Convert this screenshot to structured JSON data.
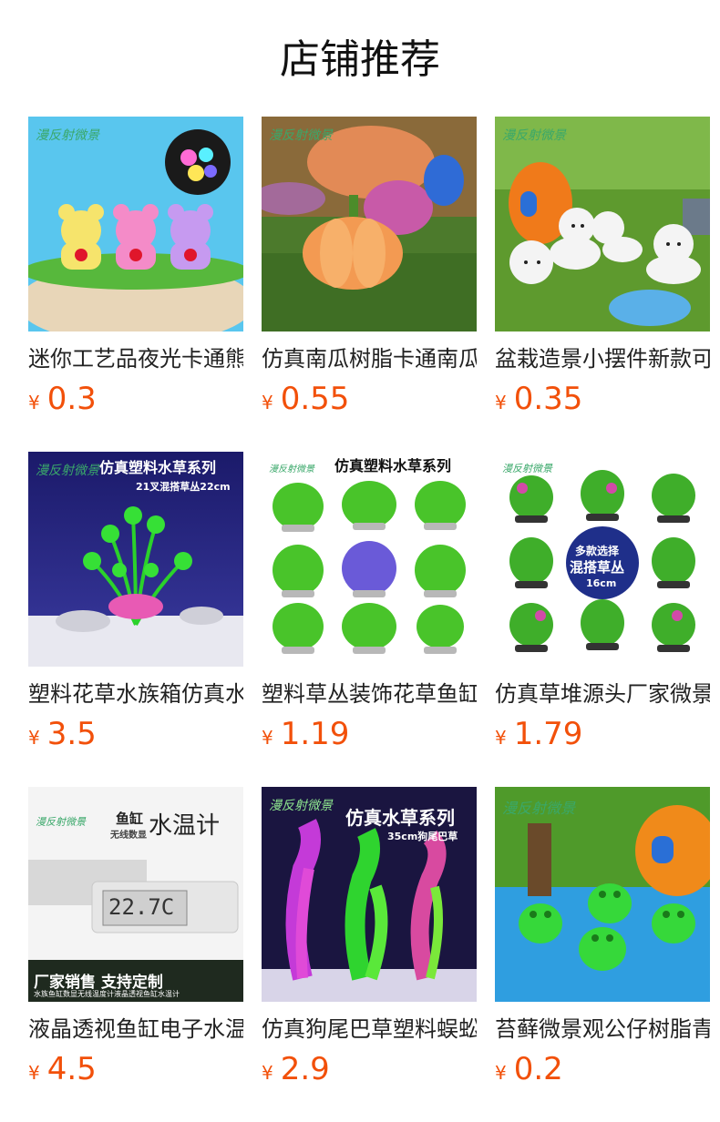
{
  "header": {
    "title": "店铺推荐"
  },
  "currency_symbol": "¥",
  "colors": {
    "price": "#f2500a",
    "text": "#222222"
  },
  "products": [
    {
      "name": "迷你工艺品夜光卡通熊",
      "price": "0.3",
      "logo_text": "漫反射微景"
    },
    {
      "name": "仿真南瓜树脂卡通南瓜",
      "price": "0.55",
      "logo_text": "漫反射微景"
    },
    {
      "name": "盆栽造景小摆件新款可爱",
      "price": "0.35",
      "logo_text": "漫反射微景"
    },
    {
      "name": "塑料花草水族箱仿真水草",
      "price": "3.5",
      "logo_text": "漫反射微景",
      "overlay_title": "仿真塑料水草系列",
      "overlay_sub": "21叉混搭草丛22cm"
    },
    {
      "name": "塑料草丛装饰花草鱼缸",
      "price": "1.19",
      "logo_text": "漫反射微景",
      "overlay_title": "仿真塑料水草系列"
    },
    {
      "name": "仿真草堆源头厂家微景观",
      "price": "1.79",
      "logo_text": "漫反射微景",
      "overlay_title": "多款选择",
      "overlay_sub": "混搭草丛",
      "overlay_extra": "16cm"
    },
    {
      "name": "液晶透视鱼缸电子水温计",
      "price": "4.5",
      "logo_text": "漫反射微景",
      "overlay_title": "水温计",
      "overlay_sub": "鱼缸",
      "overlay_extra": "无线数显",
      "display_reading": "22.7C",
      "banner": "厂家销售 支持定制",
      "banner_sub": "水族鱼缸数显无线温度计液晶透视鱼缸水温计"
    },
    {
      "name": "仿真狗尾巴草塑料蜈蚣草",
      "price": "2.9",
      "logo_text": "漫反射微景",
      "overlay_title": "仿真水草系列",
      "overlay_sub": "35cm狗尾巴草"
    },
    {
      "name": "苔藓微景观公仔树脂青蛙",
      "price": "0.2",
      "logo_text": "漫反射微景"
    }
  ]
}
